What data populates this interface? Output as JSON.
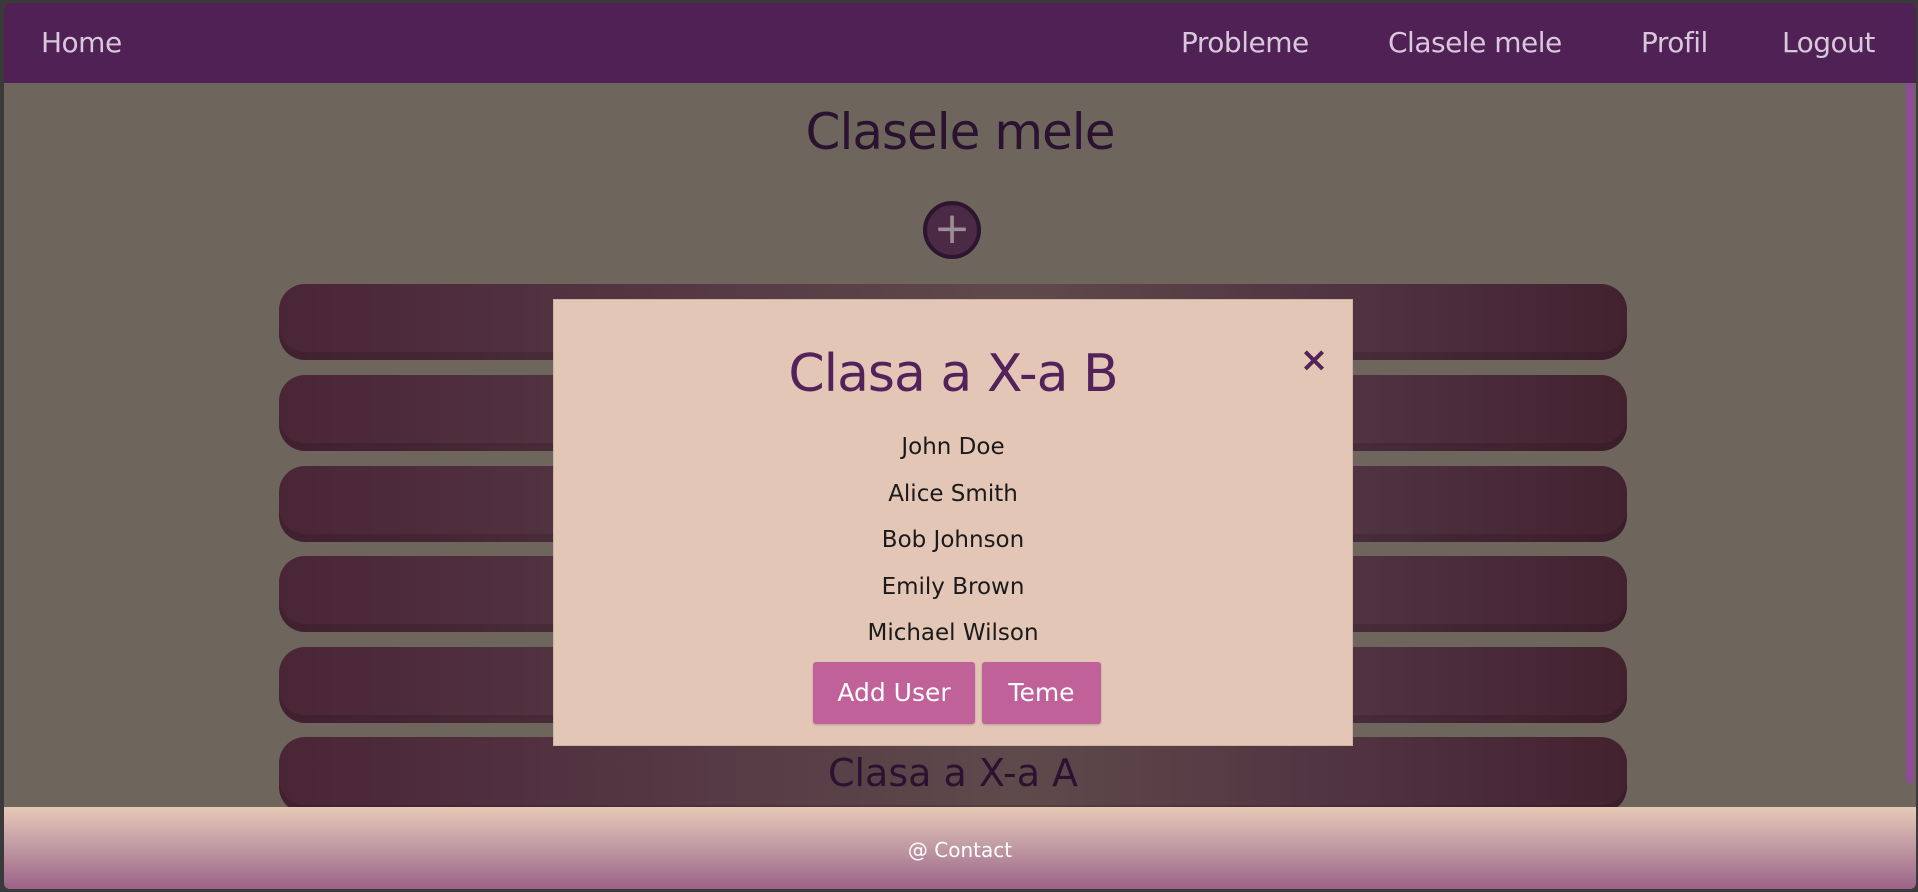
{
  "nav": {
    "home": "Home",
    "probleme": "Probleme",
    "clasele_mele": "Clasele mele",
    "profil": "Profil",
    "logout": "Logout"
  },
  "page": {
    "title": "Clasele mele",
    "add_icon": "+"
  },
  "classes": [
    {
      "label": ""
    },
    {
      "label": ""
    },
    {
      "label": ""
    },
    {
      "label": ""
    },
    {
      "label": ""
    },
    {
      "label": "Clasa a X-a A"
    }
  ],
  "modal": {
    "title": "Clasa a X-a B",
    "close_icon": "×",
    "members": [
      "John Doe",
      "Alice Smith",
      "Bob Johnson",
      "Emily Brown",
      "Michael Wilson"
    ],
    "add_user_label": "Add User",
    "teme_label": "Teme"
  },
  "footer": {
    "contact": "@ Contact"
  },
  "colors": {
    "navbar": "#4f2155",
    "background": "#6e665c",
    "modal_bg": "#e3c6b6",
    "accent_button": "#c0619a",
    "title_color": "#53225a"
  }
}
